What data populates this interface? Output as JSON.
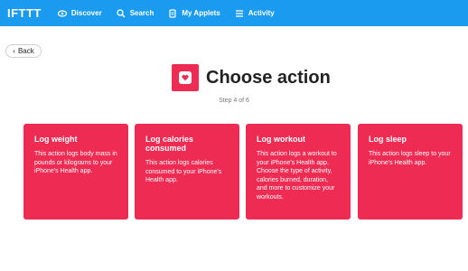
{
  "header": {
    "logo": "IFTTT",
    "nav": [
      {
        "label": "Discover",
        "icon": "eye-icon"
      },
      {
        "label": "Search",
        "icon": "search-icon"
      },
      {
        "label": "My Applets",
        "icon": "applets-icon"
      },
      {
        "label": "Activity",
        "icon": "list-icon"
      }
    ]
  },
  "back_label": "Back",
  "page": {
    "title": "Choose action",
    "step": "Step 4 of 6",
    "app_icon": "heart-icon",
    "accent": "#ee2b52"
  },
  "actions": [
    {
      "title": "Log weight",
      "desc": "This action logs body mass in pounds or kilograms to your iPhone's Health app."
    },
    {
      "title": "Log calories consumed",
      "desc": "This action logs calories consumed to your iPhone's Health app."
    },
    {
      "title": "Log workout",
      "desc": "This action logs a workout to your iPhone's Health app. Choose the type of activity, calories burned, duration, and more to customize your workouts."
    },
    {
      "title": "Log sleep",
      "desc": "This action logs sleep to your iPhone's Health app."
    }
  ],
  "colors": {
    "topbar": "#1a9bf0",
    "card": "#ee2b52"
  }
}
